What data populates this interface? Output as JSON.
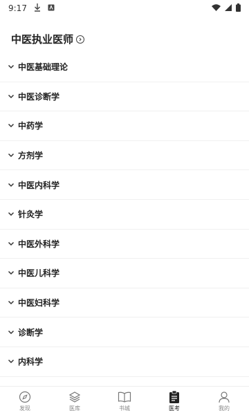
{
  "status_bar": {
    "time": "9:17",
    "icons": [
      "download-icon",
      "app-notification-icon",
      "wifi-icon",
      "signal-icon",
      "battery-icon"
    ]
  },
  "header": {
    "title": "中医执业医师",
    "title_icon": "chevron-right-circle-icon"
  },
  "categories": [
    {
      "label": "中医基础理论"
    },
    {
      "label": "中医诊断学"
    },
    {
      "label": "中药学"
    },
    {
      "label": "方剂学"
    },
    {
      "label": "中医内科学"
    },
    {
      "label": "针灸学"
    },
    {
      "label": "中医外科学"
    },
    {
      "label": "中医儿科学"
    },
    {
      "label": "中医妇科学"
    },
    {
      "label": "诊断学"
    },
    {
      "label": "内科学"
    }
  ],
  "bottom_nav": {
    "items": [
      {
        "label": "发现",
        "icon": "compass-icon"
      },
      {
        "label": "医库",
        "icon": "layers-icon"
      },
      {
        "label": "书城",
        "icon": "book-icon"
      },
      {
        "label": "医考",
        "icon": "clipboard-icon",
        "active": true
      },
      {
        "label": "我的",
        "icon": "user-icon"
      }
    ]
  },
  "colors": {
    "text": "#222222",
    "muted": "#888888",
    "divider": "#f0f0f0"
  }
}
